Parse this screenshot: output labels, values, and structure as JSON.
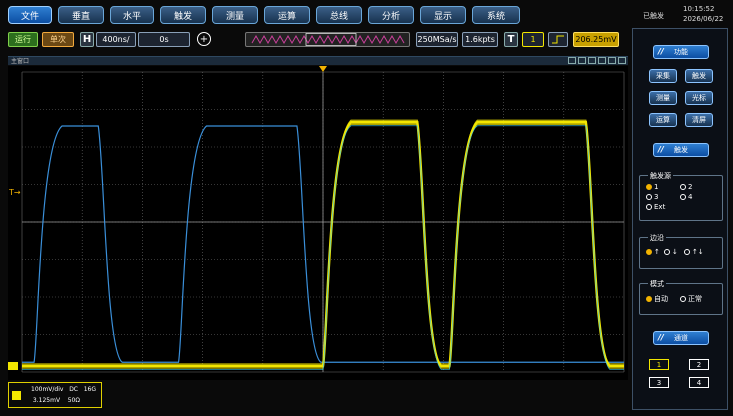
{
  "menu": [
    {
      "label": "文件",
      "active": true
    },
    {
      "label": "垂直",
      "active": false
    },
    {
      "label": "水平",
      "active": false
    },
    {
      "label": "触发",
      "active": false
    },
    {
      "label": "测量",
      "active": false
    },
    {
      "label": "运算",
      "active": false
    },
    {
      "label": "总线",
      "active": false
    },
    {
      "label": "分析",
      "active": false
    },
    {
      "label": "显示",
      "active": false
    },
    {
      "label": "系统",
      "active": false
    }
  ],
  "status": {
    "trigger": "已触发",
    "time": "10:15:52",
    "date": "2026/06/22"
  },
  "controls": {
    "run": "运行",
    "single": "单次",
    "h": "H",
    "timebase": "400ns/",
    "delay": "0s",
    "plus": "+",
    "sample_rate": "250MSa/s",
    "memory": "1.6kpts",
    "t": "T",
    "trig_source": "1",
    "trig_level": "206.25mV"
  },
  "window_title": "主窗口",
  "channel_info": {
    "scale": "100mV/div",
    "coupling": "DC",
    "bw": "16G",
    "offset": "3.125mV",
    "impedance": "50Ω"
  },
  "trigger_marker": "T",
  "panel": {
    "function_label": "功能",
    "buttons": [
      "采集",
      "触发",
      "测量",
      "光标",
      "运算",
      "清屏"
    ],
    "trigger_label": "触发",
    "source_title": "触发源",
    "sources": [
      {
        "label": "1",
        "on": true
      },
      {
        "label": "2",
        "on": false
      },
      {
        "label": "3",
        "on": false
      },
      {
        "label": "4",
        "on": false
      },
      {
        "label": "Ext",
        "on": false
      }
    ],
    "edge_title": "边沿",
    "edges": [
      {
        "label": "↑",
        "on": true
      },
      {
        "label": "↓",
        "on": false
      },
      {
        "label": "↑↓",
        "on": false
      }
    ],
    "mode_title": "模式",
    "modes": [
      {
        "label": "自动",
        "on": true
      },
      {
        "label": "正常",
        "on": false
      }
    ],
    "channel_label": "通道",
    "channels": [
      {
        "label": "1",
        "selected": true
      },
      {
        "label": "2",
        "selected": false
      },
      {
        "label": "3",
        "selected": false
      },
      {
        "label": "4",
        "selected": false
      }
    ]
  },
  "colors": {
    "ch1": "#f2e600",
    "overlay": "#3a8fd9",
    "grid": "#6c6c6c",
    "accent": "#2f7fd1"
  },
  "chart_data": {
    "type": "line",
    "divisions": {
      "x": 10,
      "y": 8
    },
    "series": [
      {
        "color": "yellow",
        "pulses": [
          {
            "rise_div": 5.0,
            "fall_div": 6.6
          },
          {
            "rise_div": 7.1,
            "fall_div": 9.4
          }
        ],
        "high_div": 6.5,
        "low_div": 0.0
      },
      {
        "color": "blue",
        "pulses": [
          {
            "rise_div": 0.2,
            "fall_div": 1.3
          },
          {
            "rise_div": 2.6,
            "fall_div": 4.6
          }
        ],
        "high_div": 6.4,
        "low_div": 0.1
      }
    ]
  }
}
